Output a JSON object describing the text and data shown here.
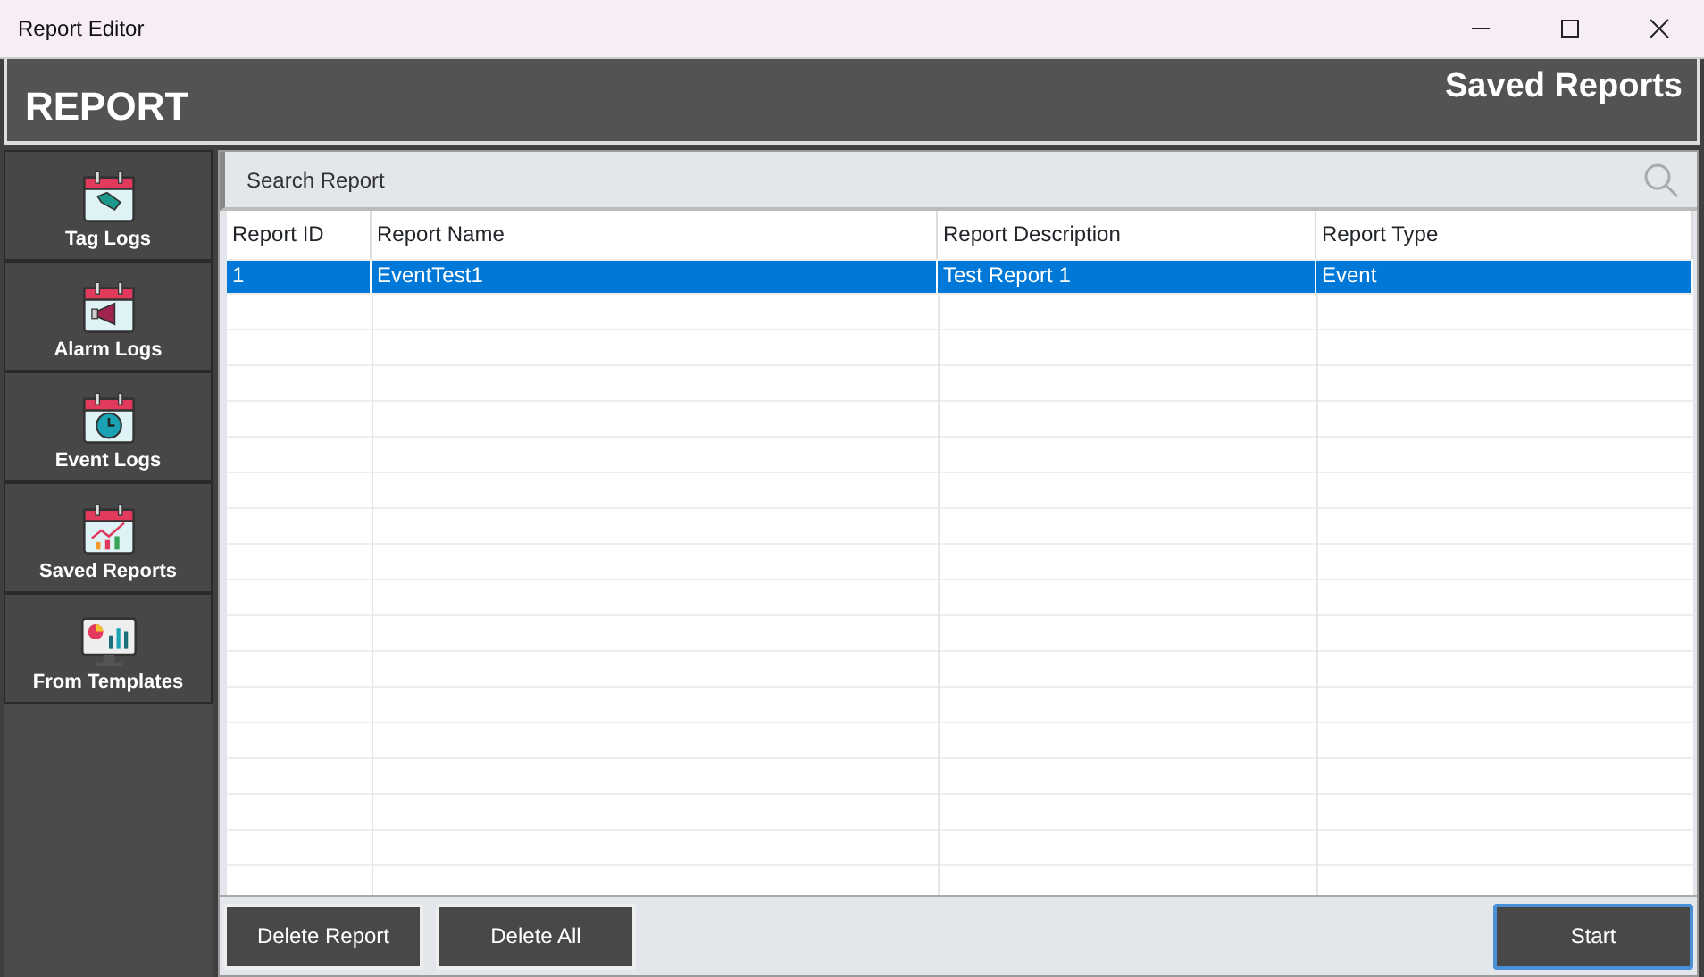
{
  "window": {
    "title": "Report Editor"
  },
  "header": {
    "title": "REPORT",
    "subtitle": "Saved Reports"
  },
  "sidebar": {
    "items": [
      {
        "label": "Tag Logs",
        "kind": "tag"
      },
      {
        "label": "Alarm Logs",
        "kind": "alarm"
      },
      {
        "label": "Event Logs",
        "kind": "clock"
      },
      {
        "label": "Saved Reports",
        "kind": "chart"
      },
      {
        "label": "From Templates",
        "kind": "monitor"
      }
    ]
  },
  "search": {
    "placeholder": "Search Report"
  },
  "table": {
    "columns": [
      "Report ID",
      "Report Name",
      "Report Description",
      "Report Type"
    ],
    "rows": [
      {
        "cells": [
          "1",
          "EventTest1",
          "Test Report 1",
          "Event"
        ],
        "selected": true
      }
    ]
  },
  "buttons": [
    {
      "label": "Delete Report",
      "focused": false
    },
    {
      "label": "Delete All",
      "focused": false
    },
    {
      "label": "Start",
      "focused": true
    }
  ]
}
